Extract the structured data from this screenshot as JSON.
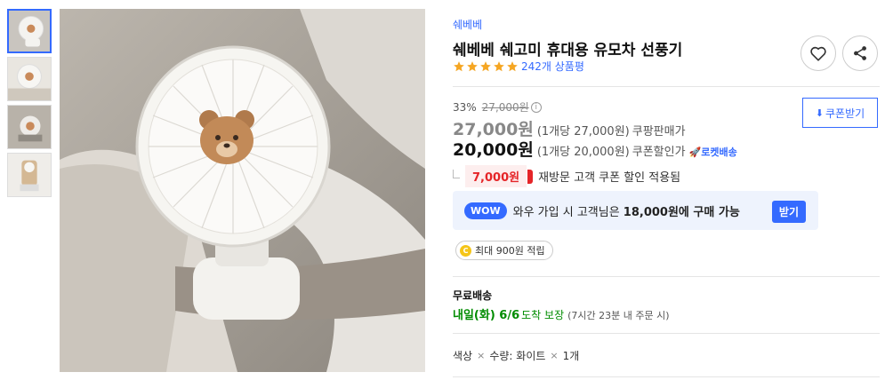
{
  "brand": "쉐베베",
  "title": "쉐베베 쉐고미 휴대용 유모차 선풍기",
  "rating": {
    "stars": 5,
    "review_count": "242개 상품평"
  },
  "icons": {
    "wishlist": "heart-icon",
    "share": "share-icon"
  },
  "price": {
    "discount_rate": "33%",
    "original": "27,000원",
    "sale_price": "27,000원",
    "sale_unit": "(1개당 27,000원)",
    "sale_label": "쿠팡판매가",
    "coupon_price": "20,000원",
    "coupon_unit": "(1개당 20,000원)",
    "coupon_label": "쿠폰할인가",
    "rocket_label": "🚀로켓배송",
    "info_mark": "i"
  },
  "coupon_button": {
    "icon": "⬇",
    "label": "쿠폰받기"
  },
  "revisit": {
    "amount": "7,000원",
    "text": "재방문 고객 쿠폰 할인 적용됨"
  },
  "wow": {
    "badge": "WOW",
    "text_prefix": "와우 가입 시 고객님은 ",
    "text_amount": "18,000원에 구매 가능",
    "button": "받기"
  },
  "reward": {
    "coin": "C",
    "text": "최대 900원 적립"
  },
  "shipping": {
    "label": "무료배송",
    "date": "내일(화) 6/6",
    "guarantee": "도착 보장",
    "note": "(7시간 23분 내 주문 시)"
  },
  "options": {
    "color_label": "색상",
    "qty_label": "수량",
    "value": "화이트",
    "qty": "1개",
    "sep": "×",
    "qty_colon": ":"
  },
  "colors": {
    "accent": "#346aff",
    "red": "#e52528",
    "green": "#008c00",
    "star": "#f5a623"
  }
}
